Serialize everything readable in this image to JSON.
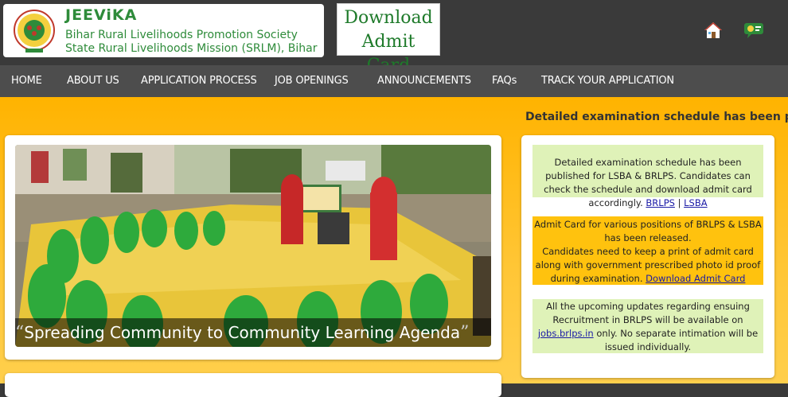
{
  "header": {
    "org_name": "JEEViKA",
    "org_line1": "Bihar Rural Livelihoods Promotion Society",
    "org_line2": "State Rural Livelihoods Mission (SRLM), Bihar",
    "download_line1": "Download",
    "download_line2": "Admit Card",
    "icons": [
      "logo-emblem",
      "home-icon",
      "language-icon"
    ]
  },
  "nav": [
    "HOME",
    "ABOUT US",
    "APPLICATION PROCESS",
    "JOB OPENINGS",
    "ANNOUNCEMENTS",
    "FAQs",
    "TRACK YOUR APPLICATION"
  ],
  "ticker": "Detailed examination schedule has been pu",
  "slider": {
    "caption": "Spreading Community to Community Learning Agenda",
    "quote_open": "“",
    "quote_close": "”"
  },
  "notices": {
    "n1_text": "Detailed examination schedule has been published for LSBA & BRLPS. Candidates can check the schedule and download admit card accordingly.",
    "n1_link1": "BRLPS",
    "n1_sep": "|",
    "n1_link2": "LSBA",
    "n2_line1": "Admit Card for various positions of BRLPS & LSBA has been released.",
    "n2_line2": "Candidates need to keep a print of admit card along with government prescribed photo id proof during examination.",
    "n2_link": "Download Admit Card",
    "n3_text_a": "All the upcoming updates regarding ensuing Recruitment in BRLPS will be available on",
    "n3_link": "jobs.brlps.in",
    "n3_text_b": "only. No separate intimation will be issued individually."
  },
  "colors": {
    "header_bg": "#3a3a3a",
    "nav_bg": "#4d4d4d",
    "brand_green": "#2e8b3a",
    "main_orange": "#ffb300",
    "notice_green": "#dff2b8",
    "notice_amber": "#ffc20e"
  }
}
